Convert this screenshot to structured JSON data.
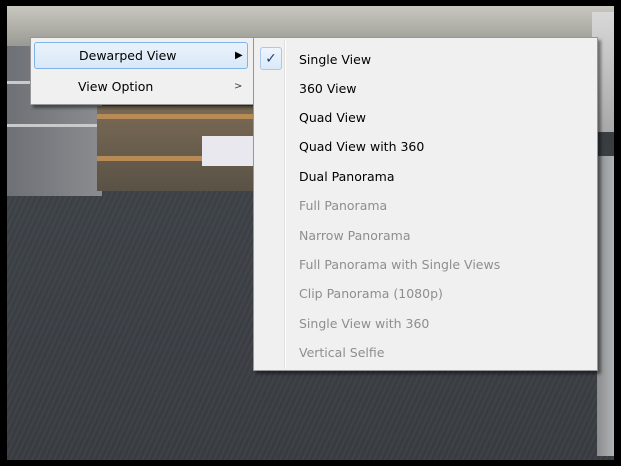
{
  "main_menu": {
    "items": [
      {
        "label": "Dewarped View",
        "has_submenu": true,
        "highlighted": true
      },
      {
        "label": "View Option",
        "has_submenu": true,
        "highlighted": false
      }
    ],
    "arrow_glyph": "▶"
  },
  "submenu": {
    "check_glyph": "✓",
    "items": [
      {
        "label": "Single View",
        "checked": true,
        "enabled": true
      },
      {
        "label": "360 View",
        "checked": false,
        "enabled": true
      },
      {
        "label": "Quad View",
        "checked": false,
        "enabled": true
      },
      {
        "label": "Quad View with 360",
        "checked": false,
        "enabled": true
      },
      {
        "label": "Dual Panorama",
        "checked": false,
        "enabled": true
      },
      {
        "label": "Full Panorama",
        "checked": false,
        "enabled": false
      },
      {
        "label": "Narrow Panorama",
        "checked": false,
        "enabled": false
      },
      {
        "label": "Full Panorama with Single Views",
        "checked": false,
        "enabled": false
      },
      {
        "label": "Clip Panorama (1080p)",
        "checked": false,
        "enabled": false
      },
      {
        "label": "Single View with 360",
        "checked": false,
        "enabled": false
      },
      {
        "label": "Vertical Selfie",
        "checked": false,
        "enabled": false
      }
    ]
  },
  "colors": {
    "menu_bg": "#f0f0f0",
    "highlight_border": "#7eb4ea",
    "disabled_text": "#8e8e8e"
  }
}
